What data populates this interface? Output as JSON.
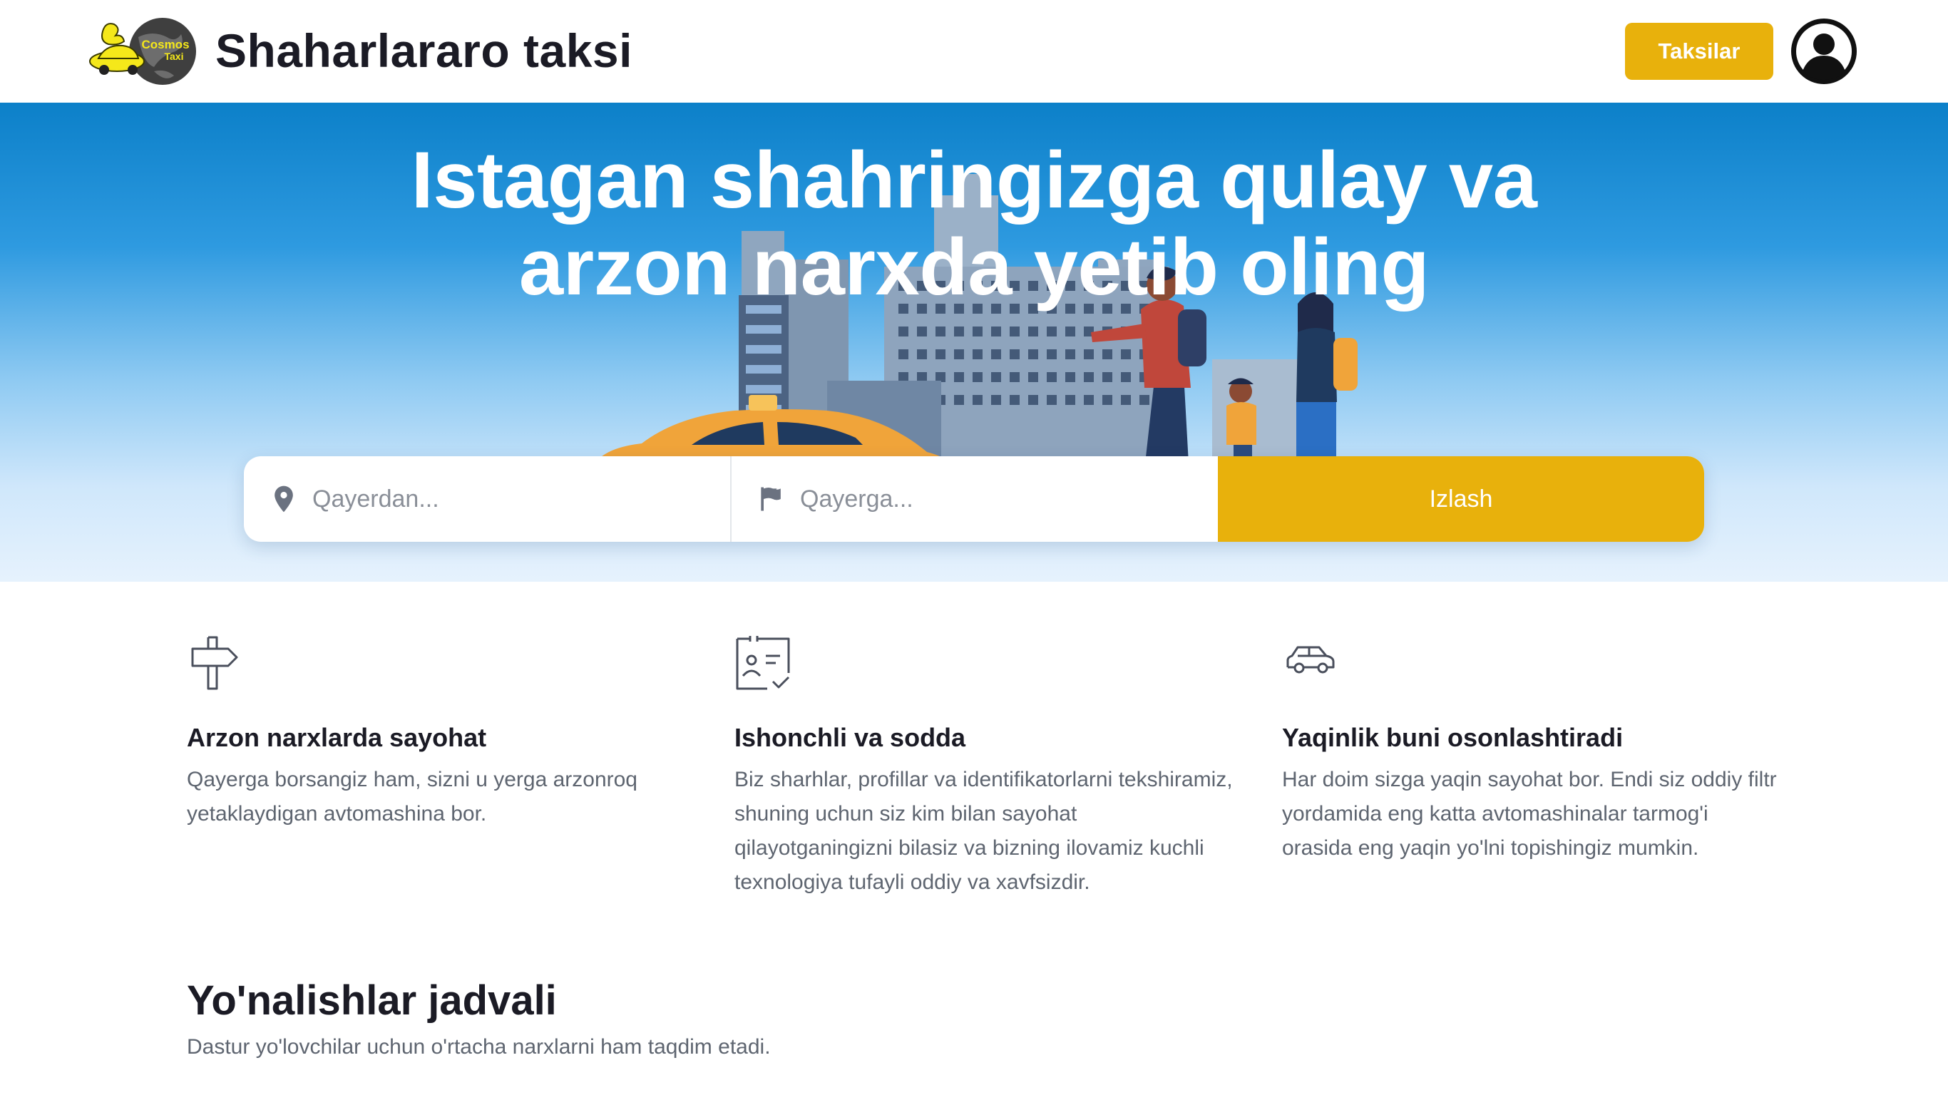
{
  "header": {
    "logo_text_line1": "Cosmos",
    "logo_text_line2": "Taxi",
    "brand": "Shaharlararo taksi",
    "taxis_button": "Taksilar"
  },
  "hero": {
    "title_line1": "Istagan shahringizga qulay va",
    "title_line2": "arzon narxda yetib oling"
  },
  "search": {
    "from_placeholder": "Qayerdan...",
    "to_placeholder": "Qayerga...",
    "search_button": "Izlash"
  },
  "features": [
    {
      "icon": "signpost-icon",
      "title": "Arzon narxlarda sayohat",
      "text": "Qayerga borsangiz ham, sizni u yerga arzonroq yetaklaydigan avtomashina bor."
    },
    {
      "icon": "id-card-check-icon",
      "title": "Ishonchli va sodda",
      "text": "Biz sharhlar, profillar va identifikatorlarni tekshiramiz, shuning uchun siz kim bilan sayohat qilayotganingizni bilasiz va bizning ilovamiz kuchli texnologiya tufayli oddiy va xavfsizdir."
    },
    {
      "icon": "car-icon",
      "title": "Yaqinlik buni osonlashtiradi",
      "text": "Har doim sizga yaqin sayohat bor. Endi siz oddiy filtr yordamida eng katta avtomashinalar tarmog'i orasida eng yaqin yo'lni topishingiz mumkin."
    }
  ],
  "routes": {
    "title": "Yo'nalishlar jadvali",
    "subtitle": "Dastur yo'lovchilar uchun o'rtacha narxlarni ham taqdim etadi."
  },
  "colors": {
    "accent": "#e8b10c",
    "text_dark": "#1b1b25",
    "text_muted": "#5e6570",
    "hero_top": "#0c80c9",
    "hero_bottom": "#e6f2fd"
  }
}
